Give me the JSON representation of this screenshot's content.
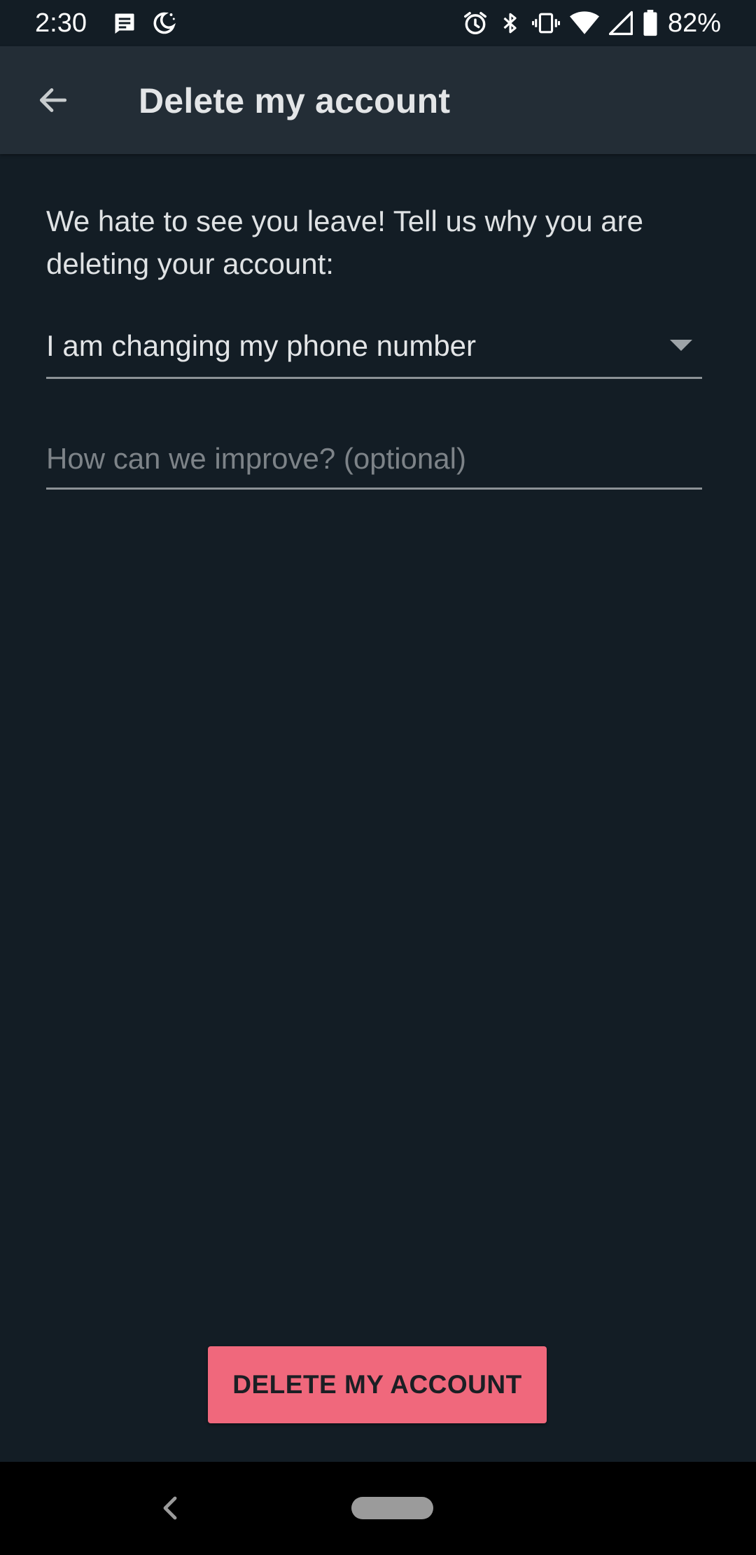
{
  "status_bar": {
    "time": "2:30",
    "battery": "82%",
    "left_icons": [
      "message-icon",
      "moon-icon"
    ],
    "right_icons": [
      "alarm-icon",
      "bluetooth-icon",
      "vibrate-icon",
      "wifi-icon",
      "cellular-signal-icon",
      "battery-icon"
    ]
  },
  "app_bar": {
    "title": "Delete my account",
    "back_icon": "arrow-left-icon"
  },
  "form": {
    "prompt": "We hate to see you leave! Tell us why you are deleting your account:",
    "reason_selected": "I am changing my phone number",
    "improve_placeholder": "How can we improve? (optional)",
    "improve_value": ""
  },
  "actions": {
    "delete_label": "DELETE MY ACCOUNT"
  },
  "nav_bar": {
    "back_icon": "chevron-left-icon",
    "home_icon": "home-pill-icon"
  },
  "colors": {
    "background": "#131d25",
    "app_bar": "#232d36",
    "accent_button": "#f0687c",
    "text": "#e3e5e7",
    "underline": "#8c9296"
  }
}
